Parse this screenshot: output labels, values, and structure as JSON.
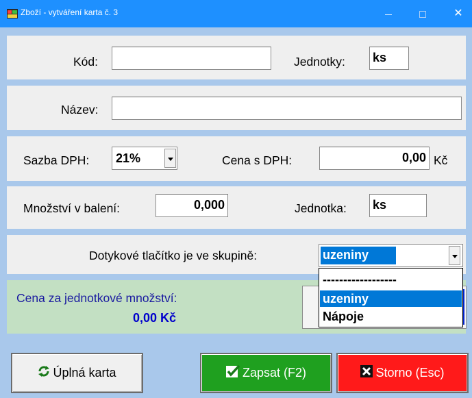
{
  "window": {
    "title": "Zboží - vytváření  karta č. 3",
    "minimize_icon": "minimize-icon",
    "maximize_icon": "maximize-icon",
    "close_icon": "close-icon",
    "close_glyph": "✕"
  },
  "form": {
    "code": {
      "label": "Kód:",
      "value": ""
    },
    "units": {
      "label": "Jednotky:",
      "value": "ks"
    },
    "name": {
      "label": "Název:",
      "value": ""
    },
    "vat_rate": {
      "label": "Sazba DPH:",
      "value": "21%"
    },
    "price_with_vat": {
      "label": "Cena s DPH:",
      "value": "0,00",
      "currency": "Kč"
    },
    "pack_quantity": {
      "label": "Množství v balení:",
      "value": "0,000"
    },
    "unit": {
      "label": "Jednotka:",
      "value": "ks"
    },
    "touch_group": {
      "label": "Dotykové tlačítko je ve skupině:",
      "value": "uzeniny",
      "options": [
        "------------------",
        "uzeniny",
        "Nápoje"
      ],
      "selected_index": 1
    },
    "unit_price": {
      "label": "Cena za jednotkové množství:",
      "value": "0,00 Kč"
    }
  },
  "buttons": {
    "full_card": {
      "label": "Úplná karta",
      "icon": "refresh-icon"
    },
    "save": {
      "label": "Zapsat (F2)",
      "icon": "checkmark-icon"
    },
    "cancel": {
      "label": "Storno (Esc)",
      "icon": "cancel-x-icon"
    }
  },
  "colors": {
    "titlebar": "#1e90ff",
    "save_button": "#1fa01f",
    "cancel_button": "#ff1a1a",
    "selected_option": "#0078d7",
    "unit_price_text": "#0000cc"
  }
}
